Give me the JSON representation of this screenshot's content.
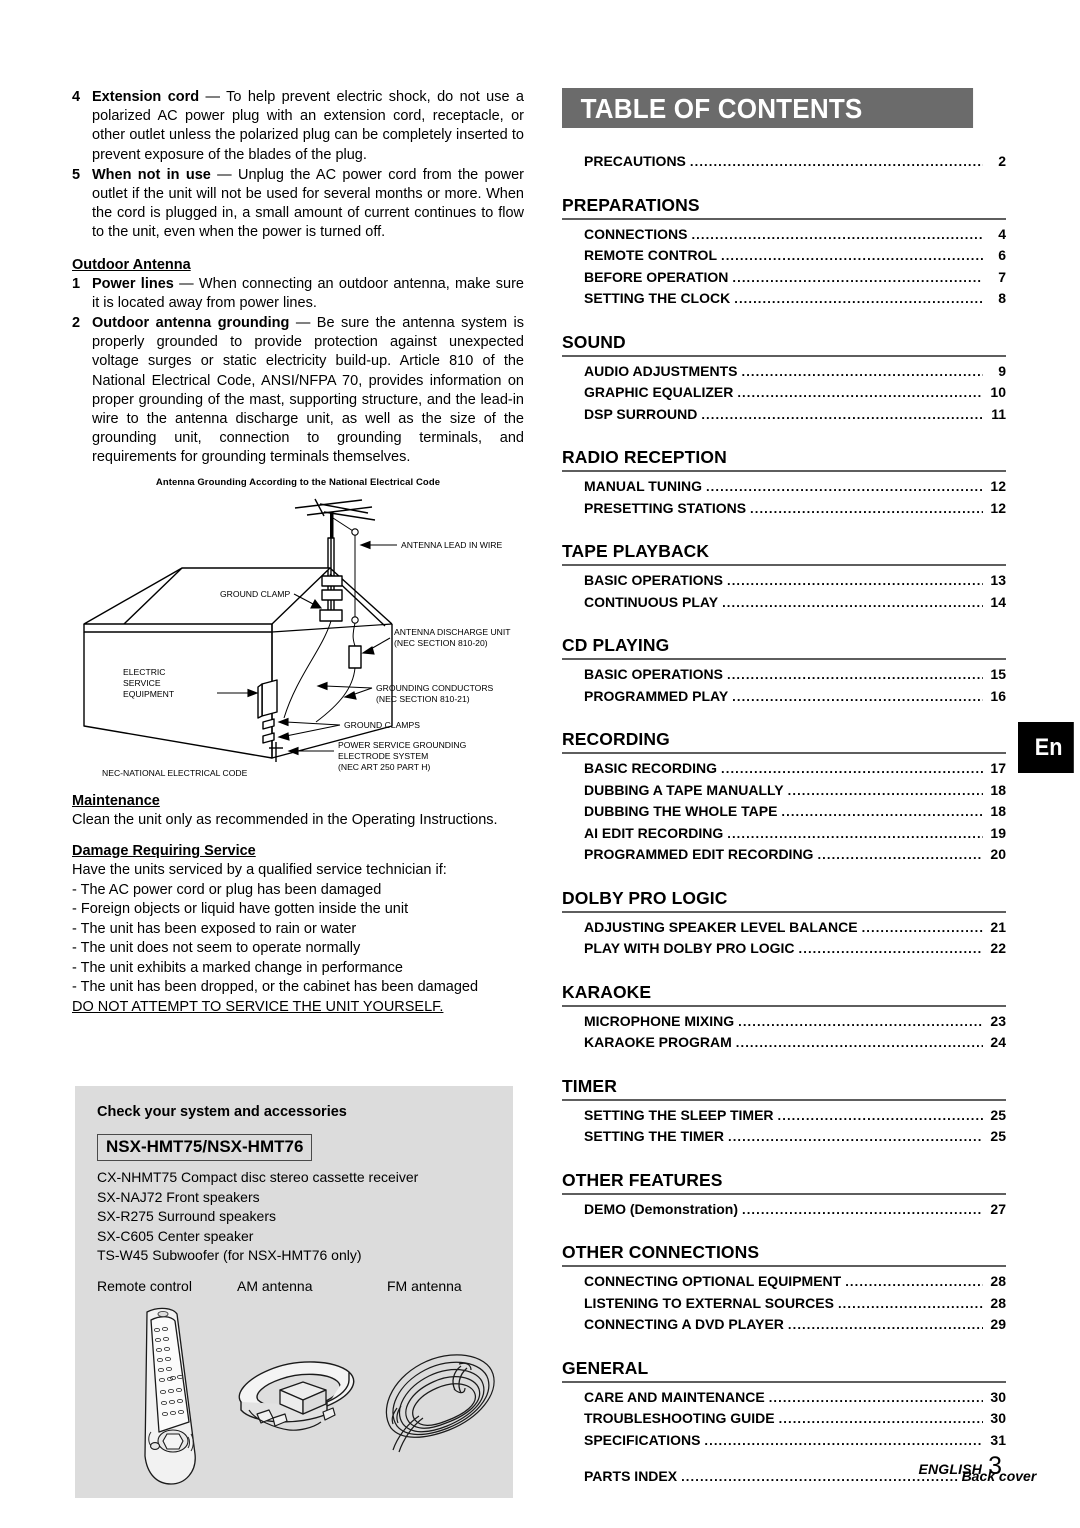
{
  "left_column": {
    "numbered_items": [
      {
        "num": "4",
        "bold": "Extension cord",
        "text": " — To help prevent electric shock, do not use a polarized AC power plug with an extension cord, receptacle, or other outlet unless the polarized plug can be completely inserted to prevent exposure of the blades of the plug."
      },
      {
        "num": "5",
        "bold": "When not in use",
        "text": " — Unplug the AC power cord from the power outlet if the unit will not be used for several months or more. When the cord is plugged in, a small amount of current continues to flow to the unit, even when the power is turned off."
      }
    ],
    "outdoor_antenna_heading": "Outdoor Antenna",
    "antenna_items": [
      {
        "num": "1",
        "bold": "Power lines",
        "text": " — When connecting an outdoor antenna, make sure it is located away from power lines."
      },
      {
        "num": "2",
        "bold": "Outdoor antenna grounding",
        "text": " — Be sure the antenna system is properly grounded to provide protection against unexpected voltage surges or static electricity build-up. Article 810 of the National Electrical Code, ANSI/NFPA 70, provides information on proper grounding of the mast, supporting structure, and the lead-in wire to the antenna discharge unit, as well as the size of the grounding unit, connection to grounding terminals, and requirements for grounding terminals themselves."
      }
    ],
    "figure_caption": "Antenna Grounding According to the National Electrical Code",
    "diagram_labels": {
      "antenna_lead_in_wire": "ANTENNA LEAD IN WIRE",
      "ground_clamp": "GROUND CLAMP",
      "antenna_discharge_unit_l1": "ANTENNA DISCHARGE UNIT",
      "antenna_discharge_unit_l2": "(NEC SECTION 810-20)",
      "electric_l1": "ELECTRIC",
      "electric_l2": "SERVICE",
      "electric_l3": "EQUIPMENT",
      "grounding_conductors_l1": "GROUNDING CONDUCTORS",
      "grounding_conductors_l2": "(NEC SECTION 810-21)",
      "ground_clamps": "GROUND CLAMPS",
      "power_service_l1": "POWER SERVICE GROUNDING",
      "power_service_l2": "ELECTRODE SYSTEM",
      "power_service_l3": "(NEC ART 250 PART H)",
      "nec_note": "NEC-NATIONAL ELECTRICAL CODE"
    },
    "maintenance_heading": "Maintenance",
    "maintenance_text": "Clean the unit only as recommended in the Operating Instructions.",
    "damage_heading": "Damage Requiring Service",
    "damage_intro": "Have the units serviced by a qualified service technician if:",
    "damage_items": [
      "- The AC power cord or plug has been damaged",
      "- Foreign objects or liquid have gotten inside the unit",
      "- The unit has been exposed to rain or water",
      "- The unit does not seem to operate normally",
      "- The unit exhibits a marked change in performance",
      "- The unit has been dropped, or the cabinet has been damaged"
    ],
    "damage_warning": "DO NOT ATTEMPT TO SERVICE THE UNIT YOURSELF."
  },
  "accessories": {
    "title": "Check your system and accessories",
    "model_box": "NSX-HMT75/NSX-HMT76",
    "items": [
      "CX-NHMT75 Compact disc stereo cassette receiver",
      "SX-NAJ72 Front speakers",
      "SX-R275 Surround speakers",
      "SX-C605 Center speaker",
      "TS-W45 Subwoofer (for NSX-HMT76 only)"
    ],
    "art_captions": {
      "remote": "Remote control",
      "am": "AM antenna",
      "fm": "FM antenna"
    }
  },
  "toc": {
    "header": "TABLE OF CONTENTS",
    "top_entry": {
      "label": "PRECAUTIONS",
      "page": "2"
    },
    "sections": [
      {
        "title": "PREPARATIONS",
        "entries": [
          {
            "label": "CONNECTIONS",
            "page": "4"
          },
          {
            "label": "REMOTE CONTROL",
            "page": "6"
          },
          {
            "label": "BEFORE OPERATION",
            "page": "7"
          },
          {
            "label": "SETTING THE CLOCK",
            "page": "8"
          }
        ]
      },
      {
        "title": "SOUND",
        "entries": [
          {
            "label": "AUDIO ADJUSTMENTS",
            "page": "9"
          },
          {
            "label": "GRAPHIC EQUALIZER",
            "page": "10"
          },
          {
            "label": "DSP SURROUND",
            "page": "11"
          }
        ]
      },
      {
        "title": "RADIO RECEPTION",
        "entries": [
          {
            "label": "MANUAL TUNING",
            "page": "12"
          },
          {
            "label": "PRESETTING STATIONS",
            "page": "12"
          }
        ]
      },
      {
        "title": "TAPE PLAYBACK",
        "entries": [
          {
            "label": "BASIC OPERATIONS",
            "page": "13"
          },
          {
            "label": "CONTINUOUS PLAY",
            "page": "14"
          }
        ]
      },
      {
        "title": "CD PLAYING",
        "entries": [
          {
            "label": "BASIC OPERATIONS",
            "page": "15"
          },
          {
            "label": "PROGRAMMED PLAY",
            "page": "16"
          }
        ]
      },
      {
        "title": "RECORDING",
        "entries": [
          {
            "label": "BASIC RECORDING",
            "page": "17"
          },
          {
            "label": "DUBBING A TAPE MANUALLY",
            "page": "18"
          },
          {
            "label": "DUBBING THE WHOLE TAPE",
            "page": "18"
          },
          {
            "label": "AI EDIT RECORDING",
            "page": "19"
          },
          {
            "label": "PROGRAMMED EDIT RECORDING",
            "page": "20"
          }
        ]
      },
      {
        "title": "DOLBY PRO LOGIC",
        "entries": [
          {
            "label": "ADJUSTING SPEAKER LEVEL BALANCE",
            "page": "21"
          },
          {
            "label": "PLAY WITH DOLBY PRO LOGIC",
            "page": "22"
          }
        ]
      },
      {
        "title": "KARAOKE",
        "entries": [
          {
            "label": "MICROPHONE MIXING",
            "page": "23"
          },
          {
            "label": "KARAOKE PROGRAM",
            "page": "24"
          }
        ]
      },
      {
        "title": "TIMER",
        "entries": [
          {
            "label": "SETTING THE SLEEP TIMER",
            "page": "25"
          },
          {
            "label": "SETTING THE TIMER",
            "page": "25"
          }
        ]
      },
      {
        "title": "OTHER FEATURES",
        "entries": [
          {
            "label": "DEMO (Demonstration)",
            "page": "27"
          }
        ]
      },
      {
        "title": "OTHER CONNECTIONS",
        "entries": [
          {
            "label": "CONNECTING OPTIONAL EQUIPMENT",
            "page": "28"
          },
          {
            "label": "LISTENING TO EXTERNAL SOURCES",
            "page": "28"
          },
          {
            "label": "CONNECTING A DVD PLAYER",
            "page": "29"
          }
        ]
      },
      {
        "title": "GENERAL",
        "entries": [
          {
            "label": "CARE AND MAINTENANCE",
            "page": "30"
          },
          {
            "label": "TROUBLESHOOTING GUIDE",
            "page": "30"
          },
          {
            "label": "SPECIFICATIONS",
            "page": "31"
          },
          {
            "label": "PARTS INDEX",
            "page": "Back cover",
            "italic_page": true,
            "spaced": true
          }
        ]
      }
    ]
  },
  "side_tab": "En",
  "footer": {
    "language": "ENGLISH",
    "page_number": "3"
  },
  "colors": {
    "header_bar": "#6b6b6b",
    "panel_bg": "#dcdcdc",
    "tab_bg": "#000000",
    "rule": "#5e5e5e"
  }
}
